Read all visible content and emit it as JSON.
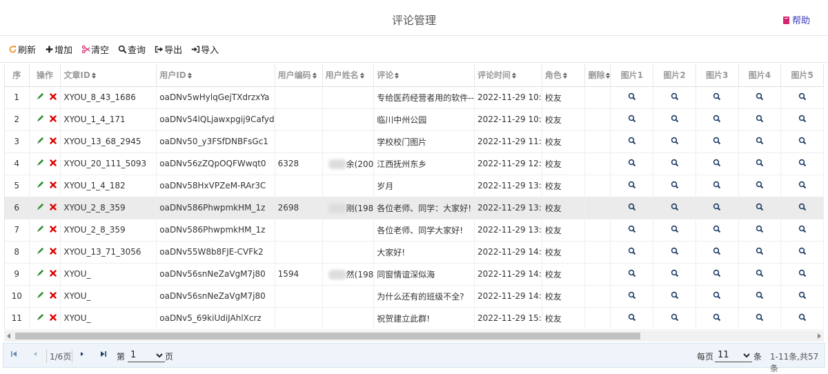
{
  "header": {
    "title": "评论管理",
    "help_label": "帮助"
  },
  "toolbar": {
    "refresh": "刷新",
    "add": "增加",
    "clear": "清空",
    "query": "查询",
    "export": "导出",
    "import": "导入"
  },
  "columns": [
    "序",
    "操作",
    "文章ID",
    "用户ID",
    "用户编码",
    "用户姓名",
    "评论",
    "评论时间",
    "角色",
    "删除",
    "图片1",
    "图片2",
    "图片3",
    "图片4",
    "图片5"
  ],
  "rows": [
    {
      "no": "1",
      "article_id": "XYOU_8_43_1686",
      "user_id": "oaDNv5wHylqGejTXdrzxYa",
      "user_code": "",
      "user_name": "",
      "comment": "专给医药经营者用的软件--",
      "time": "2022-11-29 10:",
      "role": "校友"
    },
    {
      "no": "2",
      "article_id": "XYOU_1_4_171",
      "user_id": "oaDNv54lQLjawxpgij9Cafyd",
      "user_code": "",
      "user_name": "",
      "comment": "临川中州公园",
      "time": "2022-11-29 10:",
      "role": "校友"
    },
    {
      "no": "3",
      "article_id": "XYOU_13_68_2945",
      "user_id": "oaDNv50_y3FSfDNBFsGc1",
      "user_code": "",
      "user_name": "",
      "comment": "学校校门图片",
      "time": "2022-11-29 11:",
      "role": "校友"
    },
    {
      "no": "4",
      "article_id": "XYOU_20_111_5093",
      "user_id": "oaDNv56zZQpOQFWwqt0",
      "user_code": "6328",
      "user_name": "余(200",
      "comment": "江西抚州东乡",
      "time": "2022-11-29 12:",
      "role": "校友"
    },
    {
      "no": "5",
      "article_id": "XYOU_1_4_182",
      "user_id": "oaDNv58HxVPZeM-RAr3C",
      "user_code": "",
      "user_name": "",
      "comment": "岁月",
      "time": "2022-11-29 13:",
      "role": "校友"
    },
    {
      "no": "6",
      "article_id": "XYOU_2_8_359",
      "user_id": "oaDNv586PhwpmkHM_1z",
      "user_code": "2698",
      "user_name": "刚(198",
      "comment": "各位老师、同学：大家好!",
      "time": "2022-11-29 13:",
      "role": "校友"
    },
    {
      "no": "7",
      "article_id": "XYOU_2_8_359",
      "user_id": "oaDNv586PhwpmkHM_1z",
      "user_code": "",
      "user_name": "",
      "comment": "各位老师、同学大家好!",
      "time": "2022-11-29 13:",
      "role": "校友"
    },
    {
      "no": "8",
      "article_id": "XYOU_13_71_3056",
      "user_id": "oaDNv55W8b8FJE-CVFk2",
      "user_code": "",
      "user_name": "",
      "comment": "大家好!",
      "time": "2022-11-29 14:",
      "role": "校友"
    },
    {
      "no": "9",
      "article_id": "XYOU_",
      "user_id": "oaDNv56snNeZaVgM7j80",
      "user_code": "1594",
      "user_name": "然(198",
      "comment": "同窗情谊深似海",
      "time": "2022-11-29 14:",
      "role": "校友"
    },
    {
      "no": "10",
      "article_id": "XYOU_",
      "user_id": "oaDNv56snNeZaVgM7j80",
      "user_code": "",
      "user_name": "",
      "comment": "为什么还有的班级不全?",
      "time": "2022-11-29 14:",
      "role": "校友"
    },
    {
      "no": "11",
      "article_id": "XYOU_",
      "user_id": "oaDNv5_69kiUdiJAhlXcrz",
      "user_code": "",
      "user_name": "",
      "comment": "祝贺建立此群!",
      "time": "2022-11-29 15:",
      "role": "校友"
    }
  ],
  "pager": {
    "page_info": "1/6页",
    "goto_prefix": "第",
    "goto_suffix": "页",
    "current_page": "1",
    "per_page_prefix": "每页",
    "per_page": "11",
    "per_page_suffix": "条",
    "summary": "1-11条,共57条"
  },
  "colors": {
    "accent": "#f0932b",
    "edit": "#2e8b2e",
    "delete": "#e00000",
    "pager_bg": "#eef4fa"
  }
}
